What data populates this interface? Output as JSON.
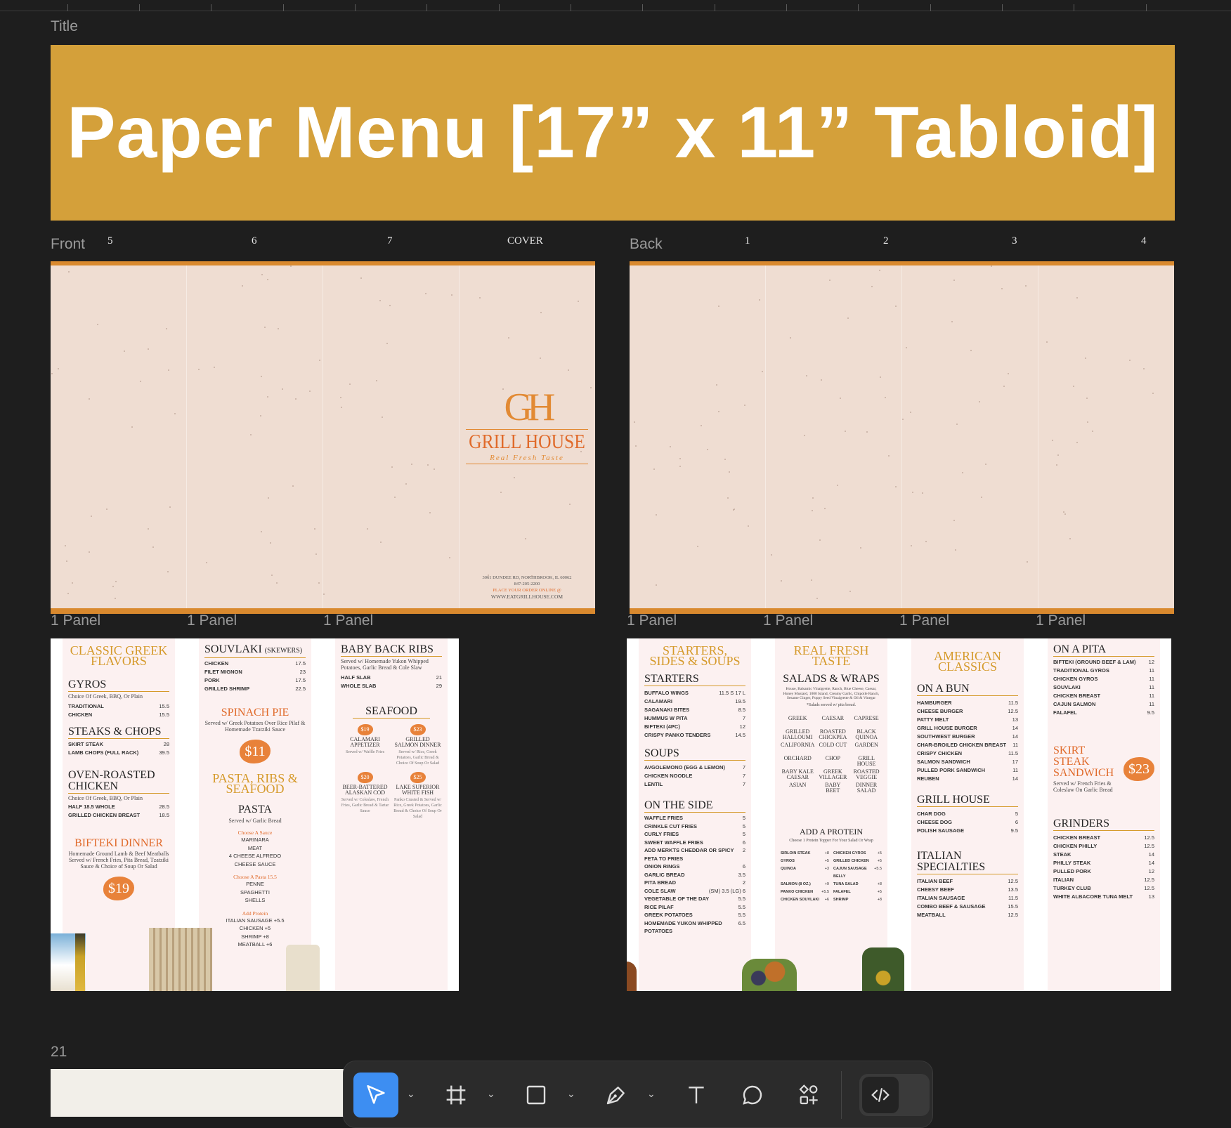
{
  "canvas": {
    "title_frame_label": "Title",
    "title_text": "Paper Menu [17” x 11” Tabloid]",
    "front_label": "Front",
    "back_label": "Back",
    "bottom_frame_label": "21",
    "front_panel_numbers": [
      "5",
      "6",
      "7",
      "COVER"
    ],
    "back_panel_numbers": [
      "1",
      "2",
      "3",
      "4"
    ],
    "panel_label": "1 Panel",
    "accent_color": "#d4a03a",
    "paper_color": "#efddd2",
    "stripe_color": "#d9892e"
  },
  "cover": {
    "logo_initials": "GH",
    "brand": "GRILL HOUSE",
    "tagline": "Real Fresh Taste",
    "address": "3061 DUNDEE RD, NORTHBROOK, IL 60062",
    "phone": "847-205-2200",
    "order_line": "PLACE YOUR ORDER ONLINE @",
    "website": "WWW.EATGRILLHOUSE.COM"
  },
  "front_menu": {
    "col1": {
      "title": "CLASSIC GREEK FLAVORS",
      "gyros": {
        "heading": "GYROS",
        "desc": "Choice Of Greek, BBQ, Or Plain",
        "items": [
          [
            "TRADITIONAL",
            "15.5"
          ],
          [
            "CHICKEN",
            "15.5"
          ]
        ]
      },
      "steaks": {
        "heading": "STEAKS & CHOPS",
        "items": [
          [
            "SKIRT STEAK",
            "28"
          ],
          [
            "LAMB CHOPS (FULL RACK)",
            "39.5"
          ]
        ]
      },
      "oven": {
        "heading": "OVEN-ROASTED CHICKEN",
        "desc": "Choice Of Greek, BBQ, Or Plain",
        "items": [
          [
            "HALF 18.5          WHOLE",
            "28.5"
          ],
          [
            "GRILLED CHICKEN BREAST",
            "18.5"
          ]
        ]
      },
      "bifteki": {
        "heading": "BIFTEKI DINNER",
        "desc": "Homemade Ground Lamb & Beef Meatballs Served w/ French Fries, Pita Bread, Tzatziki Sauce & Choice of Soup Or Salad",
        "price": "$19"
      }
    },
    "col2": {
      "souvlaki": {
        "heading": "SOUVLAKI",
        "heading_small": "(SKEWERS)",
        "items": [
          [
            "CHICKEN",
            "17.5"
          ],
          [
            "FILET MIGNON",
            "23"
          ],
          [
            "PORK",
            "17.5"
          ],
          [
            "GRILLED SHRIMP",
            "22.5"
          ]
        ]
      },
      "spinach": {
        "heading": "SPINACH PIE",
        "desc": "Served w/ Greek Potatoes Over Rice Pilaf & Homemade Tzatziki Sauce",
        "price": "$11"
      },
      "pasta_title": "PASTA, RIBS & SEAFOOD",
      "pasta": {
        "heading": "PASTA",
        "desc": "Served w/ Garlic Bread",
        "sauce_label": "Choose A Sauce",
        "sauces": [
          "MARINARA",
          "MEAT",
          "4 CHEESE ALFREDO",
          "CHEESE SAUCE"
        ],
        "pasta_label": "Choose A Pasta 15.5",
        "pastas": [
          "PENNE",
          "SPAGHETTI",
          "SHELLS"
        ],
        "protein_label": "Add Protein",
        "proteins": [
          "ITALIAN SAUSAGE +5.5",
          "CHICKEN +5",
          "SHRIMP +8",
          "MEATBALL +6"
        ]
      }
    },
    "col3": {
      "ribs": {
        "heading": "BABY BACK RIBS",
        "desc": "Served w/ Homemade Yukon Whipped Potatoes, Garlic Bread & Cole Slaw",
        "items": [
          [
            "HALF SLAB",
            "21"
          ],
          [
            "WHOLE SLAB",
            "29"
          ]
        ]
      },
      "seafood": {
        "heading": "SEAFOOD",
        "items": [
          {
            "price": "$19",
            "name": "CALAMARI APPETIZER",
            "desc": "Served w/ Waffle Fries"
          },
          {
            "price": "$23",
            "name": "GRILLED SALMON DINNER",
            "desc": "Served w/ Rice, Greek Potatoes, Garlic Bread & Choice Of Soup Or Salad"
          },
          {
            "price": "$20",
            "name": "BEER-BATTERED ALASKAN COD",
            "desc": "Served w/ Coleslaw, French Fries, Garlic Bread & Tartar Sauce"
          },
          {
            "price": "$25",
            "name": "LAKE SUPERIOR WHITE FISH",
            "desc": "Panko Crusted & Served w/ Rice, Greek Potatoes, Garlic Bread & Choice Of Soup Or Salad"
          }
        ]
      }
    }
  },
  "back_menu": {
    "col1": {
      "title": "STARTERS, SIDES & SOUPS",
      "starters": {
        "heading": "STARTERS",
        "items": [
          [
            "BUFFALO WINGS",
            "11.5 S  17 L"
          ],
          [
            "CALAMARI",
            "19.5"
          ],
          [
            "SAGANAKI BITES",
            "8.5"
          ],
          [
            "HUMMUS W PITA",
            "7"
          ],
          [
            "BIFTEKI (4PC)",
            "12"
          ],
          [
            "CRISPY PANKO TENDERS",
            "14.5"
          ]
        ]
      },
      "soups": {
        "heading": "SOUPS",
        "items": [
          [
            "AVGOLEMONO (EGG & LEMON)",
            "7"
          ],
          [
            "CHICKEN NOODLE",
            "7"
          ],
          [
            "LENTIL",
            "7"
          ]
        ]
      },
      "side": {
        "heading": "ON THE SIDE",
        "items": [
          [
            "WAFFLE FRIES",
            "5"
          ],
          [
            "CRINKLE CUT FRIES",
            "5"
          ],
          [
            "CURLY FRIES",
            "5"
          ],
          [
            "SWEET WAFFLE FRIES",
            "6"
          ],
          [
            "ADD MERKTS CHEDDAR OR SPICY FETA TO FRIES",
            "2"
          ],
          [
            "ONION RINGS",
            "6"
          ],
          [
            "GARLIC BREAD",
            "3.5"
          ],
          [
            "PITA BREAD",
            "2"
          ],
          [
            "COLE SLAW",
            "(sm) 3.5 (lg) 6"
          ],
          [
            "VEGETABLE OF THE DAY",
            "5.5"
          ],
          [
            "RICE PILAF",
            "5.5"
          ],
          [
            "GREEK POTATOES",
            "5.5"
          ],
          [
            "HOMEMADE YUKON WHIPPED POTATOES",
            "6.5"
          ]
        ]
      }
    },
    "col2": {
      "title": "REAL FRESH TASTE",
      "salads": {
        "heading": "SALADS & WRAPS",
        "desc": "House, Balsamic Vinaigrette, Ranch, Blue Cheese, Caesar, Honey Mustard, 1000 Island, Creamy Garlic, Chipotle Ranch, Sesame Ginger, Poppy Seed Vinaigrette & Oil & Vinegar",
        "note": "*Salads served w/ pita bread.",
        "items": [
          "GREEK",
          "CAESAR",
          "CAPRESE",
          "GRILLED HALLOUMI",
          "ROASTED CHICKPEA",
          "BLACK QUINOA",
          "CALIFORNIA",
          "COLD CUT",
          "GARDEN",
          "ORCHARD",
          "CHOP",
          "GRILL HOUSE",
          "BABY KALE CAESAR",
          "GREEK VILLAGER",
          "ROASTED VEGGIE",
          "ASIAN",
          "BABY BEET",
          "DINNER SALAD"
        ]
      },
      "protein": {
        "heading": "ADD A PROTEIN",
        "desc": "Choose 1 Protein Topper For Your Salad Or Wrap",
        "items": [
          [
            "SIRLOIN STEAK",
            "+8"
          ],
          [
            "CHICKEN GYROS",
            "+5"
          ],
          [
            "GYROS",
            "+5"
          ],
          [
            "GRILLED CHICKEN",
            "+5"
          ],
          [
            "QUINOA",
            "+3"
          ],
          [
            "CAJUN SAUSAGE BELLY",
            "+5.5"
          ],
          [
            "SALMON (8 OZ.)",
            "+9"
          ],
          [
            "TUNA SALAD",
            "+8"
          ],
          [
            "PANKO CHICKEN",
            "+5.5"
          ],
          [
            "FALAFEL",
            "+5"
          ],
          [
            "CHICKEN SOUVLAKI",
            "+6"
          ],
          [
            "SHRIMP",
            "+8"
          ]
        ]
      }
    },
    "col3": {
      "title": "AMERICAN CLASSICS",
      "bun": {
        "heading": "ON A BUN",
        "items": [
          [
            "HAMBURGER",
            "11.5"
          ],
          [
            "CHEESE BURGER",
            "12.5"
          ],
          [
            "PATTY MELT",
            "13"
          ],
          [
            "GRILL HOUSE BURGER",
            "14"
          ],
          [
            "SOUTHWEST BURGER",
            "14"
          ],
          [
            "CHAR-BROILED CHICKEN BREAST",
            "11"
          ],
          [
            "CRISPY CHICKEN",
            "11.5"
          ],
          [
            "SALMON SANDWICH",
            "17"
          ],
          [
            "PULLED PORK SANDWICH",
            "11"
          ],
          [
            "REUBEN",
            "14"
          ]
        ]
      },
      "grill": {
        "heading": "GRILL HOUSE",
        "items": [
          [
            "CHAR DOG",
            "5"
          ],
          [
            "CHEESE DOG",
            "6"
          ],
          [
            "POLISH SAUSAGE",
            "9.5"
          ]
        ]
      },
      "italian": {
        "heading": "ITALIAN SPECIALTIES",
        "items": [
          [
            "ITALIAN BEEF",
            "12.5"
          ],
          [
            "CHEESY BEEF",
            "13.5"
          ],
          [
            "ITALIAN SAUSAGE",
            "11.5"
          ],
          [
            "COMBO BEEF & SAUSAGE",
            "15.5"
          ],
          [
            "MEATBALL",
            "12.5"
          ]
        ]
      }
    },
    "col4": {
      "pita": {
        "heading": "ON A PITA",
        "items": [
          [
            "BIFTEKI (GROUND BEEF & LAM)",
            "12"
          ],
          [
            "TRADITIONAL GYROS",
            "11"
          ],
          [
            "CHICKEN GYROS",
            "11"
          ],
          [
            "SOUVLAKI",
            "11"
          ],
          [
            "CHICKEN BREAST",
            "11"
          ],
          [
            "CAJUN SALMON",
            "11"
          ],
          [
            "FALAFEL",
            "9.5"
          ]
        ]
      },
      "skirt": {
        "heading": "SKIRT STEAK SANDWICH",
        "desc": "Served w/ French Fries & Coleslaw On Garlic Bread",
        "price": "$23"
      },
      "grinders": {
        "heading": "GRINDERS",
        "items": [
          [
            "CHICKEN BREAST",
            "12.5"
          ],
          [
            "CHICKEN PHILLY",
            "12.5"
          ],
          [
            "STEAK",
            "14"
          ],
          [
            "PHILLY STEAK",
            "14"
          ],
          [
            "PULLED PORK",
            "12"
          ],
          [
            "ITALIAN",
            "12.5"
          ],
          [
            "TURKEY CLUB",
            "12.5"
          ],
          [
            "WHITE ALBACORE TUNA MELT",
            "13"
          ]
        ]
      }
    }
  },
  "toolbar": {
    "tools": [
      "move-tool",
      "frame-tool",
      "shape-tool",
      "pen-tool",
      "text-tool",
      "comment-tool",
      "components-tool",
      "dev-mode-toggle"
    ],
    "active_color": "#3d8ef2"
  }
}
